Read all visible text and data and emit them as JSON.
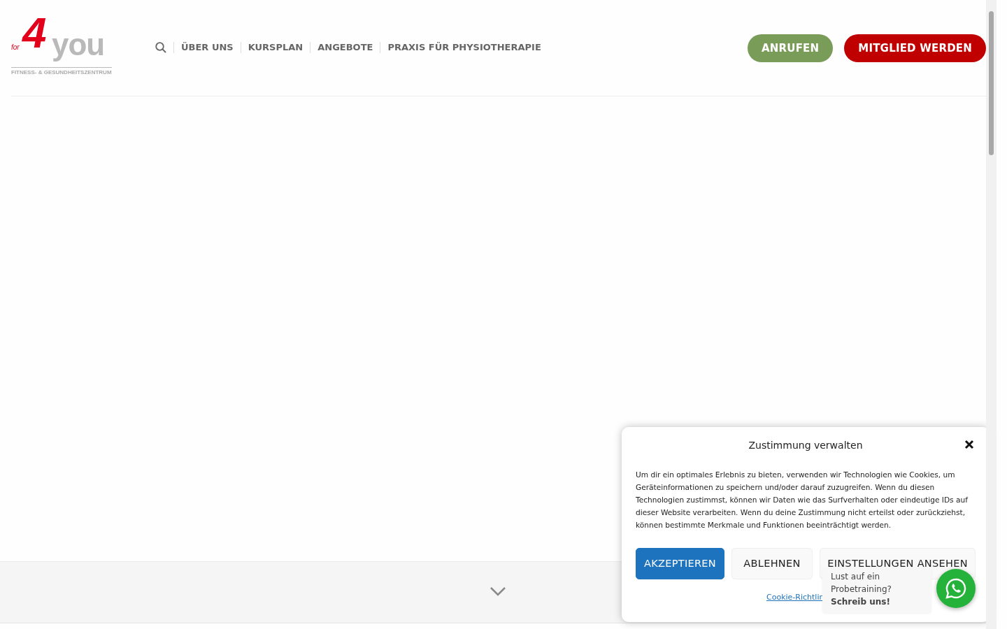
{
  "logo": {
    "numeral": "4",
    "small": "for",
    "word": "you",
    "tagline": "FITNESS- & GESUNDHEITSZENTRUM"
  },
  "nav": {
    "items": [
      "ÜBER UNS",
      "KURSPLAN",
      "ANGEBOTE",
      "PRAXIS FÜR PHYSIOTHERAPIE"
    ]
  },
  "header_buttons": [
    {
      "label": "ANRUFEN",
      "kind": "call"
    },
    {
      "label": "MITGLIED WERDEN",
      "kind": "join"
    }
  ],
  "cookie_dialog": {
    "title": "Zustimmung verwalten",
    "text": "Um dir ein optimales Erlebnis zu bieten, verwenden wir Technologien wie Cookies, um Geräteinformationen zu speichern und/oder darauf zuzugreifen. Wenn du diesen Technologien zustimmst, können wir Daten wie das Surfverhalten oder eindeutige IDs auf dieser Website verarbeiten. Wenn du deine Zustimmung nicht erteilst oder zurückziehst, können bestimmte Merkmale und Funktionen beeinträchtigt werden.",
    "buttons": [
      {
        "label": "AKZEPTIEREN",
        "kind": "primary"
      },
      {
        "label": "ABLEHNEN",
        "kind": "secondary"
      },
      {
        "label": "EINSTELLUNGEN ANSEHEN",
        "kind": "secondary"
      }
    ],
    "link": "Cookie-Richtlin"
  },
  "chat_bubble": {
    "lines": [
      "Lust auf ein",
      "Probetraining?"
    ],
    "bold": "Schreib uns!"
  }
}
